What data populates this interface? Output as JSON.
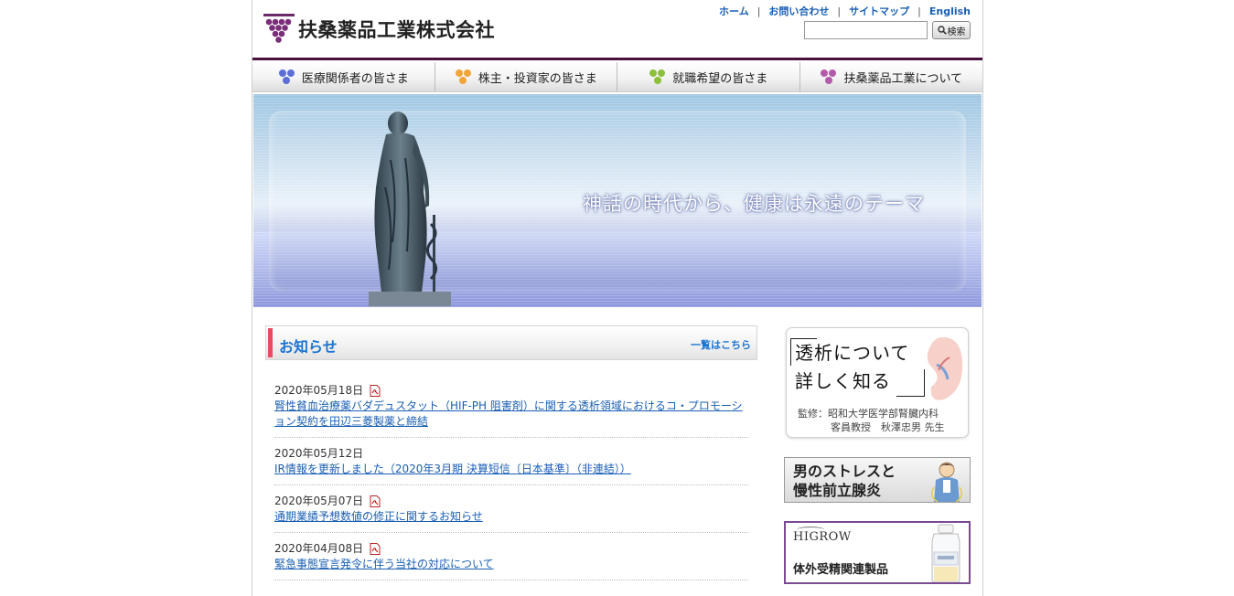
{
  "header": {
    "logo_text": "扶桑薬品工業株式会社",
    "util_nav": [
      {
        "label": "ホーム"
      },
      {
        "label": "お問い合わせ"
      },
      {
        "label": "サイトマップ"
      },
      {
        "label": "English"
      }
    ],
    "search": {
      "value": "",
      "button_label": "検索"
    }
  },
  "global_nav": [
    {
      "label": "医療関係者の皆さま",
      "color": "#5b6fd6"
    },
    {
      "label": "株主・投資家の皆さま",
      "color": "#f0a43a"
    },
    {
      "label": "就職希望の皆さま",
      "color": "#8cbf3a"
    },
    {
      "label": "扶桑薬品工業について",
      "color": "#b45aa8"
    }
  ],
  "hero": {
    "tagline": "神話の時代から、健康は永遠のテーマ"
  },
  "news": {
    "title": "お知らせ",
    "view_all": "一覧はこちら",
    "items": [
      {
        "date": "2020年05月18日",
        "pdf": true,
        "text": "腎性貧血治療薬バダデュスタット（HIF-PH 阻害剤）に関する透析領域におけるコ・プロモーション契約を田辺三菱製薬と締結"
      },
      {
        "date": "2020年05月12日",
        "pdf": false,
        "text": "IR情報を更新しました（2020年3月期 決算短信〔日本基準〕（非連結））"
      },
      {
        "date": "2020年05月07日",
        "pdf": true,
        "text": "通期業績予想数値の修正に関するお知らせ"
      },
      {
        "date": "2020年04月08日",
        "pdf": true,
        "text": "緊急事態宣言発令に伴う当社の対応について"
      }
    ]
  },
  "sidebar": {
    "dialysis": {
      "title_line1": "透析について",
      "title_line2": "詳しく知る",
      "credit_line1": "監修：昭和大学医学部腎臓内科",
      "credit_line2": "客員教授　秋澤忠男 先生"
    },
    "stress": {
      "line1": "男のストレスと",
      "line2": "慢性前立腺炎"
    },
    "higrow": {
      "logo": "HIGROW",
      "text": "体外受精関連製品"
    }
  },
  "colors": {
    "accent_purple": "#4a1040",
    "link": "#1a5fb4",
    "news_bar": "#e84b63"
  }
}
